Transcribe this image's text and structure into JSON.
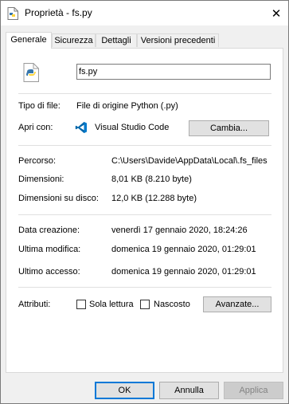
{
  "window": {
    "title": "Proprietà - fs.py",
    "close_glyph": "✕"
  },
  "tabs": [
    {
      "label": "Generale",
      "active": true
    },
    {
      "label": "Sicurezza",
      "active": false
    },
    {
      "label": "Dettagli",
      "active": false
    },
    {
      "label": "Versioni precedenti",
      "active": false
    }
  ],
  "general": {
    "file_name": "fs.py",
    "file_type_label": "Tipo di file:",
    "file_type_value": "File di origine Python (.py)",
    "open_with_label": "Apri con:",
    "open_with_value": "Visual Studio Code",
    "change_button": "Cambia...",
    "location_label": "Percorso:",
    "location_value": "C:\\Users\\Davide\\AppData\\Local\\.fs_files",
    "size_label": "Dimensioni:",
    "size_value": "8,01 KB (8.210 byte)",
    "size_on_disk_label": "Dimensioni su disco:",
    "size_on_disk_value": "12,0 KB (12.288 byte)",
    "created_label": "Data creazione:",
    "created_value": "venerdì 17 gennaio 2020, 18:24:26",
    "modified_label": "Ultima modifica:",
    "modified_value": "domenica 19 gennaio 2020, 01:29:01",
    "accessed_label": "Ultimo accesso:",
    "accessed_value": "domenica 19 gennaio 2020, 01:29:01",
    "attributes_label": "Attributi:",
    "readonly_label": "Sola lettura",
    "hidden_label": "Nascosto",
    "advanced_button": "Avanzate..."
  },
  "footer": {
    "ok": "OK",
    "cancel": "Annulla",
    "apply": "Applica"
  },
  "colors": {
    "accent": "#0078d7",
    "python_blue": "#3776ab",
    "python_yellow": "#ffd43b",
    "vscode_blue": "#0065a9"
  }
}
